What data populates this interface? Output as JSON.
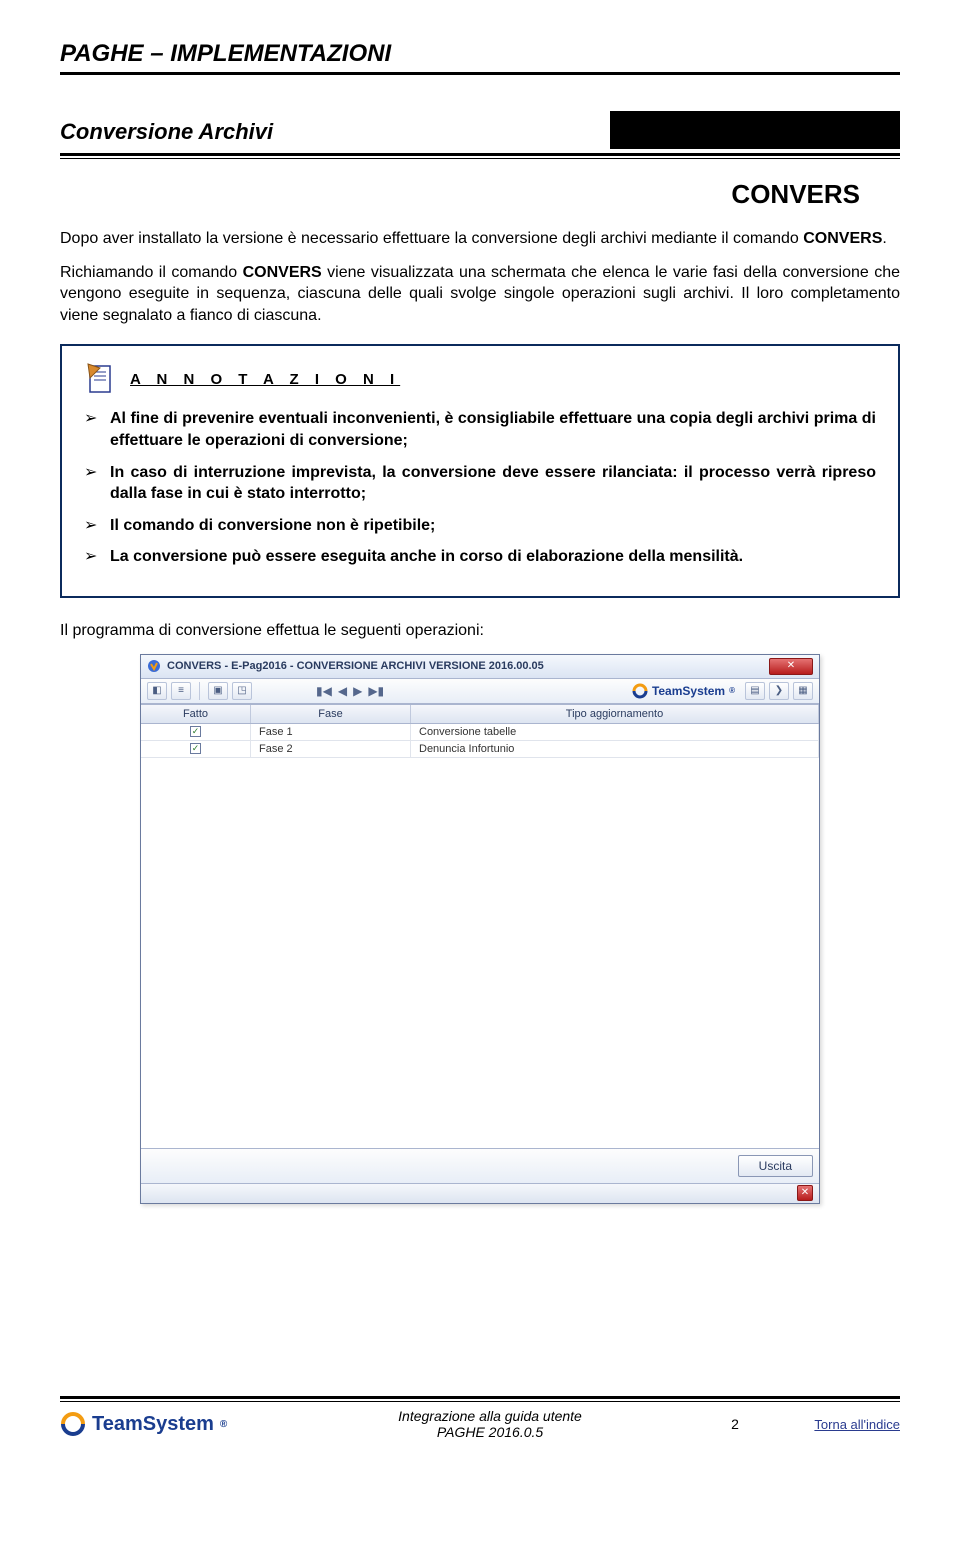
{
  "header": {
    "title": "PAGHE – IMPLEMENTAZIONI"
  },
  "subheader": {
    "title": "Conversione Archivi"
  },
  "section_label": "CONVERS",
  "paragraphs": {
    "p1_a": "Dopo aver installato la versione è necessario effettuare la conversione degli archivi mediante il comando ",
    "p1_b": "CONVERS",
    "p1_c": ".",
    "p2_a": "Richiamando il comando ",
    "p2_b": "CONVERS",
    "p2_c": " viene visualizzata una schermata che elenca le varie fasi della conversione che vengono eseguite in sequenza, ciascuna delle quali svolge singole operazioni sugli archivi. Il loro completamento viene segnalato a fianco di ciascuna."
  },
  "annot": {
    "title": "A N N O T A Z I O N I",
    "items": [
      "Al fine di prevenire eventuali inconvenienti, è consigliabile effettuare una copia degli archivi prima di effettuare le operazioni di conversione;",
      "In caso di interruzione imprevista, la conversione deve essere rilanciata: il processo verrà ripreso dalla fase in cui è stato interrotto;",
      "Il comando di conversione non è ripetibile;",
      "La conversione può essere eseguita anche in corso di elaborazione della mensilità."
    ]
  },
  "after_box": "Il programma di conversione effettua le seguenti operazioni:",
  "window": {
    "title": "CONVERS - E-Pag2016 - CONVERSIONE ARCHIVI VERSIONE 2016.00.05",
    "brand": "TeamSystem",
    "columns": {
      "c1": "Fatto",
      "c2": "Fase",
      "c3": "Tipo aggiornamento"
    },
    "rows": [
      {
        "fase": "Fase 1",
        "tipo": "Conversione tabelle"
      },
      {
        "fase": "Fase 2",
        "tipo": "Denuncia Infortunio"
      }
    ],
    "exit_btn": "Uscita"
  },
  "footer": {
    "brand": "TeamSystem",
    "center1": "Integrazione alla guida utente",
    "center2": "PAGHE 2016.0.5",
    "page": "2",
    "link": "Torna all'indice"
  }
}
